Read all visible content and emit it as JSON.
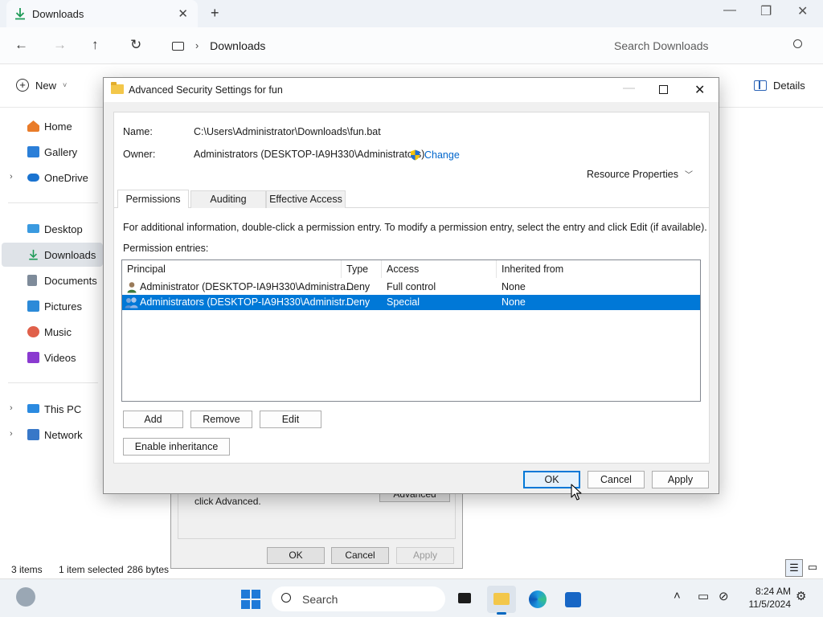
{
  "explorer": {
    "tab_title": "Downloads",
    "breadcrumb": "Downloads",
    "search_placeholder": "Search Downloads",
    "new_label": "New",
    "details_label": "Details",
    "sidebar": {
      "items": [
        {
          "label": "Home",
          "icon": "home-icon",
          "color": "#e97c2a"
        },
        {
          "label": "Gallery",
          "icon": "gallery-icon",
          "color": "#2b7fd8"
        },
        {
          "label": "OneDrive",
          "icon": "cloud-icon",
          "color": "#1a73d0"
        },
        {
          "label": "Desktop",
          "icon": "desktop-icon",
          "color": "#3a9ae0"
        },
        {
          "label": "Downloads",
          "icon": "download-icon",
          "color": "#1d9a57"
        },
        {
          "label": "Documents",
          "icon": "documents-icon",
          "color": "#7e8b9a"
        },
        {
          "label": "Pictures",
          "icon": "pictures-icon",
          "color": "#2c8ad8"
        },
        {
          "label": "Music",
          "icon": "music-icon",
          "color": "#e0604a"
        },
        {
          "label": "Videos",
          "icon": "videos-icon",
          "color": "#8a3ad0"
        },
        {
          "label": "This PC",
          "icon": "pc-icon",
          "color": "#2b8ae0"
        },
        {
          "label": "Network",
          "icon": "network-icon",
          "color": "#3878c8"
        }
      ]
    },
    "status": {
      "items": "3 items",
      "selected": "1 item selected",
      "size": "286 bytes"
    }
  },
  "properties_dialog": {
    "hint_text": "click Advanced.",
    "advanced_label": "Advanced",
    "ok_label": "OK",
    "cancel_label": "Cancel",
    "apply_label": "Apply"
  },
  "advanced_dialog": {
    "title": "Advanced Security Settings for fun",
    "name_label": "Name:",
    "name_value": "C:\\Users\\Administrator\\Downloads\\fun.bat",
    "owner_label": "Owner:",
    "owner_value": "Administrators (DESKTOP-IA9H330\\Administrators)",
    "change_label": "Change",
    "resource_properties": "Resource Properties",
    "tabs": [
      "Permissions",
      "Auditing",
      "Effective Access"
    ],
    "info_text": "For additional information, double-click a permission entry. To modify a permission entry, select the entry and click Edit (if available).",
    "entries_label": "Permission entries:",
    "columns": [
      "Principal",
      "Type",
      "Access",
      "Inherited from"
    ],
    "rows": [
      {
        "principal": "Administrator (DESKTOP-IA9H330\\Administra...",
        "type": "Deny",
        "access": "Full control",
        "inherited": "None"
      },
      {
        "principal": "Administrators (DESKTOP-IA9H330\\Administr...",
        "type": "Deny",
        "access": "Special",
        "inherited": "None"
      }
    ],
    "add_label": "Add",
    "remove_label": "Remove",
    "edit_label": "Edit",
    "enable_inheritance_label": "Enable inheritance",
    "ok_label": "OK",
    "cancel_label": "Cancel",
    "apply_label": "Apply"
  },
  "taskbar": {
    "search_label": "Search",
    "time": "8:24 AM",
    "date": "11/5/2024"
  },
  "colors": {
    "selection": "#0078d7",
    "link": "#0066cc",
    "accent": "#1f7ad8"
  }
}
